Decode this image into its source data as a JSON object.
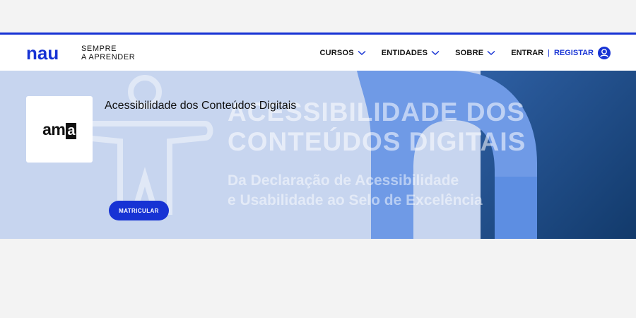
{
  "brand": {
    "logo": "nau",
    "tagline_line1": "SEMPRE",
    "tagline_line2": "A APRENDER",
    "accent": "#1733d4"
  },
  "nav": {
    "items": [
      {
        "label": "CURSOS",
        "icon": "chevron-down-icon"
      },
      {
        "label": "ENTIDADES",
        "icon": "chevron-down-icon"
      },
      {
        "label": "SOBRE",
        "icon": "chevron-down-icon"
      }
    ],
    "login_label": "ENTRAR",
    "separator": "|",
    "register_label": "REGISTAR",
    "user_icon": "user-circle-icon"
  },
  "banner": {
    "headline_line1": "ACESSIBILIDADE DOS",
    "headline_line2": "CONTEÚDOS DIGITAIS",
    "sub_line1": "Da Declaração de Acessibilidade",
    "sub_line2": "e Usabilidade ao Selo de Excelência",
    "org_logo_text_a": "am",
    "org_logo_text_b": "a",
    "course_title": "Acessibilidade dos Conteúdos Digitais",
    "enroll_label": "MATRICULAR"
  }
}
